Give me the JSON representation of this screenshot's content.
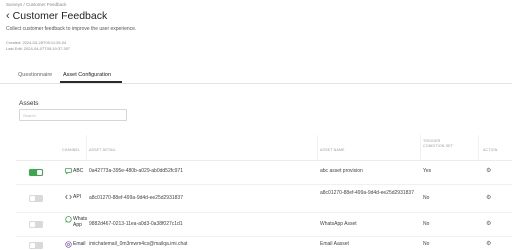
{
  "breadcrumb": "Surveys / Customer Feedback",
  "header": {
    "title": "Customer Feedback",
    "subtitle": "Collect customer feedback to improve the user experience.",
    "created": "Created: 2024-03-28T09:11:26.04",
    "last_edit": "Last Edit: 2024-04-07T05:19:37.397"
  },
  "tabs": [
    {
      "label": "Questionnaire"
    },
    {
      "label": "Asset Configuration"
    }
  ],
  "active_tab": "Asset Configuration",
  "assets": {
    "section_label": "Assets",
    "search_placeholder": "Search"
  },
  "table": {
    "headers": {
      "channel": "CHANNEL",
      "asset_detail": "ASSET DETAIL",
      "asset_name": "ASSET NAME",
      "trigger_condition": "TRIGGER CONDITION SET",
      "action": "ACTION"
    },
    "rows": [
      {
        "enabled": true,
        "channel": "ABC",
        "channel_icon": "chat-bubble-icon",
        "asset_detail": "0a42773a-395e-480b-a029-ab0dd52fc971",
        "asset_name": "abc asset provision",
        "trigger_condition": "Yes"
      },
      {
        "enabled": false,
        "channel": "API",
        "channel_icon": "code-icon",
        "asset_detail": "a8c01270-88ef-499a-9d4d-ee25d2931837",
        "asset_name": "a8c01270-88ef-499a-9d4d-ee25d2931837",
        "trigger_condition": "No"
      },
      {
        "enabled": false,
        "channel": "Whats App",
        "channel_icon": "whatsapp-icon",
        "asset_detail": "9882d467-0213-11ea-a0d3-0a38f027c1d1",
        "asset_name": "WhatsApp Asset",
        "trigger_condition": "No"
      },
      {
        "enabled": false,
        "channel": "Email",
        "channel_icon": "at-sign-icon",
        "asset_detail": "imichatemail_0m3mwm4cs@mailqa.imi.chat",
        "asset_name": "Email Aasset",
        "trigger_condition": "No"
      }
    ]
  },
  "colors": {
    "toggle_on": "#3aa84c",
    "toggle_off": "#d9d9d9",
    "tab_active_underline": "#2b2b2b"
  }
}
